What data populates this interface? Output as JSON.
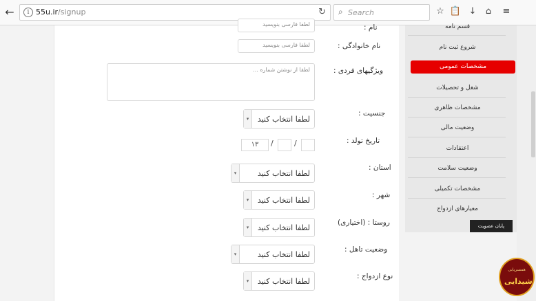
{
  "browser": {
    "url_domain": "55u.ir",
    "url_path": "/signup",
    "search_placeholder": "Search",
    "back_icon": "arrow-left-icon",
    "reload_icon": "reload-icon",
    "search_icon": "magnifier-icon",
    "toolbar_icons": [
      "star-icon",
      "clipboard-icon",
      "download-icon",
      "home-icon",
      "menu-icon"
    ]
  },
  "form": {
    "name_label": "نام :",
    "name_placeholder": "لطفا فارسی بنویسید",
    "family_label": "نام خانوادگی :",
    "family_placeholder": "لطفا فارسی بنویسید",
    "traits_label": "ویژگیهای فردی :",
    "traits_placeholder": "لطفا از نوشتن شماره ...",
    "gender_label": "جنسیت :",
    "gender_value": "لطفا انتخاب کنید",
    "birth_label": "تاریخ تولد :",
    "birth_year_value": "۱۳",
    "province_label": "استان :",
    "province_value": "لطفا انتخاب کنید",
    "city_label": "شهر :",
    "city_value": "لطفا انتخاب کنید",
    "village_label": "روستا : (اختیاری)",
    "village_value": "لطفا انتخاب کنید",
    "marital_label": "وضعیت تاهل :",
    "marital_value": "لطفا انتخاب کنید",
    "marriage_type_label": "نوع ازدواج :",
    "marriage_type_value": "لطفا انتخاب کنید"
  },
  "sidebar": {
    "items": [
      {
        "label": "قسم نامه"
      },
      {
        "label": "شروع ثبت نام"
      },
      {
        "label": "مشخصات عمومی",
        "active": true
      },
      {
        "label": "شغل و تحصیلات"
      },
      {
        "label": "مشخصات ظاهری"
      },
      {
        "label": "وضعیت مالی"
      },
      {
        "label": "اعتقادات"
      },
      {
        "label": "وضعیت سلامت"
      },
      {
        "label": "مشخصات تکمیلی"
      },
      {
        "label": "معیارهای ازدواج"
      }
    ],
    "finish_button": "پایان عضویت"
  },
  "logo": {
    "sub": "همسریابی",
    "main": "شیدایی"
  }
}
